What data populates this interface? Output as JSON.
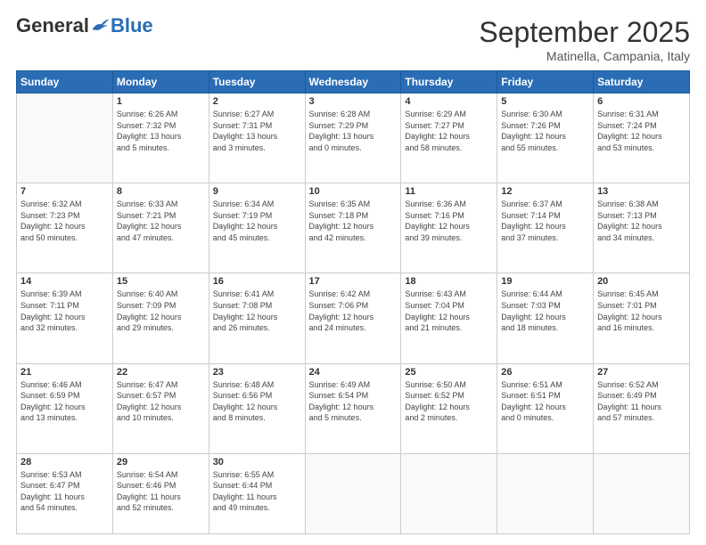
{
  "logo": {
    "general": "General",
    "blue": "Blue"
  },
  "title": "September 2025",
  "subtitle": "Matinella, Campania, Italy",
  "days_of_week": [
    "Sunday",
    "Monday",
    "Tuesday",
    "Wednesday",
    "Thursday",
    "Friday",
    "Saturday"
  ],
  "weeks": [
    [
      {
        "day": "",
        "info": ""
      },
      {
        "day": "1",
        "info": "Sunrise: 6:26 AM\nSunset: 7:32 PM\nDaylight: 13 hours\nand 5 minutes."
      },
      {
        "day": "2",
        "info": "Sunrise: 6:27 AM\nSunset: 7:31 PM\nDaylight: 13 hours\nand 3 minutes."
      },
      {
        "day": "3",
        "info": "Sunrise: 6:28 AM\nSunset: 7:29 PM\nDaylight: 13 hours\nand 0 minutes."
      },
      {
        "day": "4",
        "info": "Sunrise: 6:29 AM\nSunset: 7:27 PM\nDaylight: 12 hours\nand 58 minutes."
      },
      {
        "day": "5",
        "info": "Sunrise: 6:30 AM\nSunset: 7:26 PM\nDaylight: 12 hours\nand 55 minutes."
      },
      {
        "day": "6",
        "info": "Sunrise: 6:31 AM\nSunset: 7:24 PM\nDaylight: 12 hours\nand 53 minutes."
      }
    ],
    [
      {
        "day": "7",
        "info": "Sunrise: 6:32 AM\nSunset: 7:23 PM\nDaylight: 12 hours\nand 50 minutes."
      },
      {
        "day": "8",
        "info": "Sunrise: 6:33 AM\nSunset: 7:21 PM\nDaylight: 12 hours\nand 47 minutes."
      },
      {
        "day": "9",
        "info": "Sunrise: 6:34 AM\nSunset: 7:19 PM\nDaylight: 12 hours\nand 45 minutes."
      },
      {
        "day": "10",
        "info": "Sunrise: 6:35 AM\nSunset: 7:18 PM\nDaylight: 12 hours\nand 42 minutes."
      },
      {
        "day": "11",
        "info": "Sunrise: 6:36 AM\nSunset: 7:16 PM\nDaylight: 12 hours\nand 39 minutes."
      },
      {
        "day": "12",
        "info": "Sunrise: 6:37 AM\nSunset: 7:14 PM\nDaylight: 12 hours\nand 37 minutes."
      },
      {
        "day": "13",
        "info": "Sunrise: 6:38 AM\nSunset: 7:13 PM\nDaylight: 12 hours\nand 34 minutes."
      }
    ],
    [
      {
        "day": "14",
        "info": "Sunrise: 6:39 AM\nSunset: 7:11 PM\nDaylight: 12 hours\nand 32 minutes."
      },
      {
        "day": "15",
        "info": "Sunrise: 6:40 AM\nSunset: 7:09 PM\nDaylight: 12 hours\nand 29 minutes."
      },
      {
        "day": "16",
        "info": "Sunrise: 6:41 AM\nSunset: 7:08 PM\nDaylight: 12 hours\nand 26 minutes."
      },
      {
        "day": "17",
        "info": "Sunrise: 6:42 AM\nSunset: 7:06 PM\nDaylight: 12 hours\nand 24 minutes."
      },
      {
        "day": "18",
        "info": "Sunrise: 6:43 AM\nSunset: 7:04 PM\nDaylight: 12 hours\nand 21 minutes."
      },
      {
        "day": "19",
        "info": "Sunrise: 6:44 AM\nSunset: 7:03 PM\nDaylight: 12 hours\nand 18 minutes."
      },
      {
        "day": "20",
        "info": "Sunrise: 6:45 AM\nSunset: 7:01 PM\nDaylight: 12 hours\nand 16 minutes."
      }
    ],
    [
      {
        "day": "21",
        "info": "Sunrise: 6:46 AM\nSunset: 6:59 PM\nDaylight: 12 hours\nand 13 minutes."
      },
      {
        "day": "22",
        "info": "Sunrise: 6:47 AM\nSunset: 6:57 PM\nDaylight: 12 hours\nand 10 minutes."
      },
      {
        "day": "23",
        "info": "Sunrise: 6:48 AM\nSunset: 6:56 PM\nDaylight: 12 hours\nand 8 minutes."
      },
      {
        "day": "24",
        "info": "Sunrise: 6:49 AM\nSunset: 6:54 PM\nDaylight: 12 hours\nand 5 minutes."
      },
      {
        "day": "25",
        "info": "Sunrise: 6:50 AM\nSunset: 6:52 PM\nDaylight: 12 hours\nand 2 minutes."
      },
      {
        "day": "26",
        "info": "Sunrise: 6:51 AM\nSunset: 6:51 PM\nDaylight: 12 hours\nand 0 minutes."
      },
      {
        "day": "27",
        "info": "Sunrise: 6:52 AM\nSunset: 6:49 PM\nDaylight: 11 hours\nand 57 minutes."
      }
    ],
    [
      {
        "day": "28",
        "info": "Sunrise: 6:53 AM\nSunset: 6:47 PM\nDaylight: 11 hours\nand 54 minutes."
      },
      {
        "day": "29",
        "info": "Sunrise: 6:54 AM\nSunset: 6:46 PM\nDaylight: 11 hours\nand 52 minutes."
      },
      {
        "day": "30",
        "info": "Sunrise: 6:55 AM\nSunset: 6:44 PM\nDaylight: 11 hours\nand 49 minutes."
      },
      {
        "day": "",
        "info": ""
      },
      {
        "day": "",
        "info": ""
      },
      {
        "day": "",
        "info": ""
      },
      {
        "day": "",
        "info": ""
      }
    ]
  ]
}
